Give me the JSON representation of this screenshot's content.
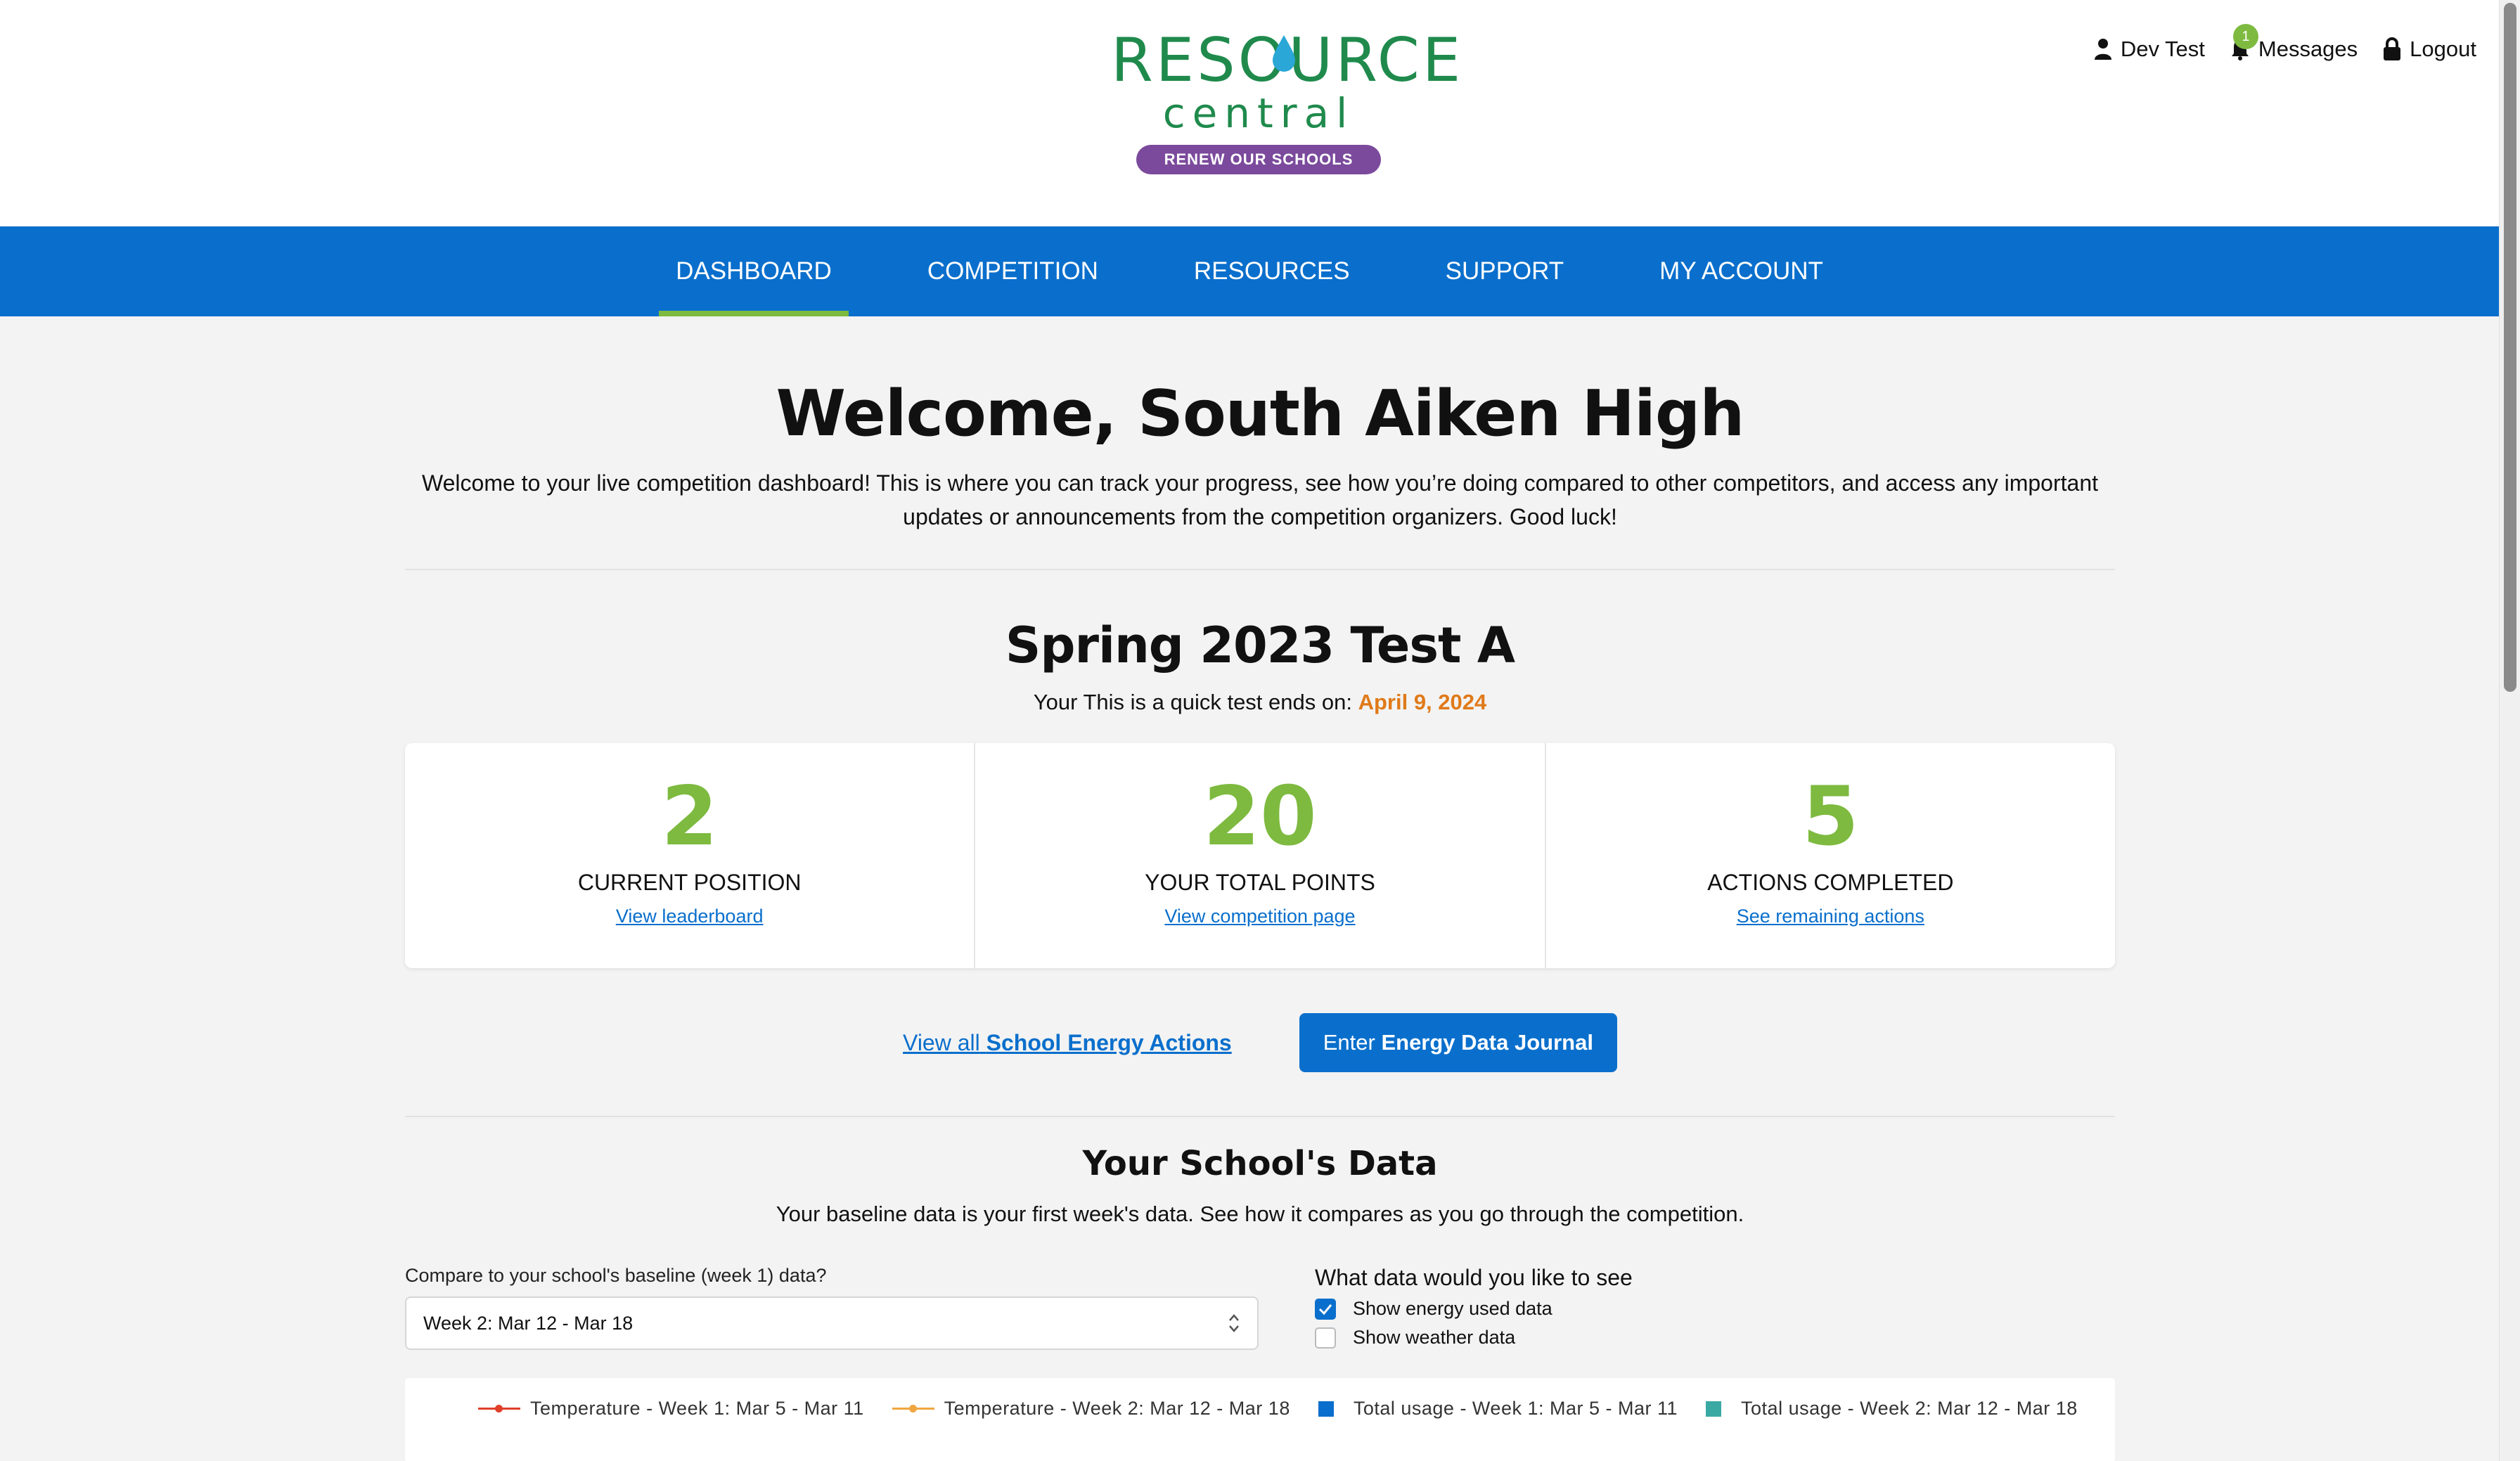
{
  "header": {
    "logo_line1": "RESOURCE",
    "logo_line2": "central",
    "logo_badge": "RENEW OUR SCHOOLS",
    "user_name": "Dev Test",
    "messages_label": "Messages",
    "messages_count": "1",
    "logout_label": "Logout"
  },
  "nav": {
    "items": [
      {
        "label": "DASHBOARD",
        "active": true
      },
      {
        "label": "COMPETITION"
      },
      {
        "label": "RESOURCES"
      },
      {
        "label": "SUPPORT"
      },
      {
        "label": "MY ACCOUNT"
      }
    ]
  },
  "welcome": {
    "title": "Welcome, South Aiken High",
    "text": "Welcome to your live competition dashboard! This is where you can track your progress, see how you’re doing compared to other competitors, and access any important updates or announcements from the competition organizers. Good luck!"
  },
  "competition": {
    "title": "Spring 2023 Test A",
    "sub_prefix": "Your This is a quick test ends on:",
    "end_date": "April 9, 2024",
    "stats": [
      {
        "value": "2",
        "label": "CURRENT POSITION",
        "link": "View leaderboard"
      },
      {
        "value": "20",
        "label": "YOUR TOTAL POINTS",
        "link": "View competition page"
      },
      {
        "value": "5",
        "label": "ACTIONS COMPLETED",
        "link": "See remaining actions"
      }
    ],
    "view_all_prefix": "View all",
    "view_all_bold": "School Energy Actions",
    "enter_prefix": "Enter",
    "enter_bold": "Energy Data Journal"
  },
  "school_data": {
    "title": "Your School's Data",
    "subtitle": "Your baseline data is your first week's data. See how it compares as you go through the competition.",
    "compare_label": "Compare to your school's baseline (week 1) data?",
    "compare_selected": "Week 2: Mar 12 - Mar 18",
    "see_question": "What data would you like to see",
    "checkbox_energy": "Show energy used data",
    "checkbox_weather": "Show weather data",
    "energy_checked": true,
    "weather_checked": false,
    "legend": [
      {
        "label": "Temperature - Week 1: Mar 5 - Mar 11",
        "color": "#e0402a",
        "kind": "line"
      },
      {
        "label": "Temperature - Week 2: Mar 12 - Mar 18",
        "color": "#f0a640",
        "kind": "line"
      },
      {
        "label": "Total usage - Week 1: Mar 5 - Mar 11",
        "color": "#0a6fcc",
        "kind": "square"
      },
      {
        "label": "Total usage - Week 2: Mar 12 - Mar 18",
        "color": "#3aa9a3",
        "kind": "square"
      }
    ]
  },
  "colors": {
    "primary": "#0a6fcc",
    "accent_green": "#7dba3f",
    "date_orange": "#e07a1a",
    "badge_purple": "#7b4a9c"
  }
}
